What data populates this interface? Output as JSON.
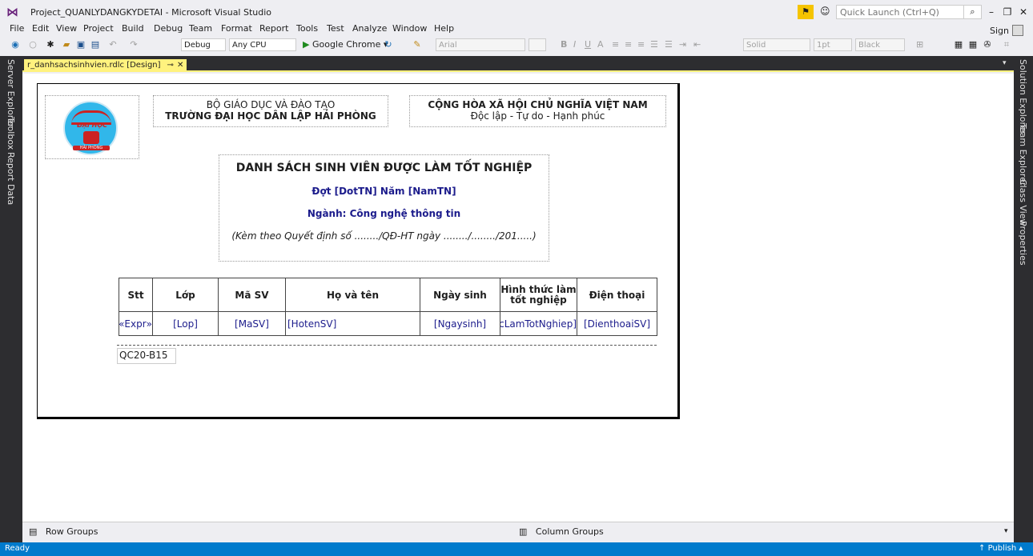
{
  "window": {
    "title": "Project_QUANLYDANGKYDETAI - Microsoft Visual Studio",
    "quick_launch_placeholder": "Quick Launch (Ctrl+Q)",
    "sign_in": "Sign in"
  },
  "menu": [
    "File",
    "Edit",
    "View",
    "Project",
    "Build",
    "Debug",
    "Team",
    "Format",
    "Report",
    "Tools",
    "Test",
    "Analyze",
    "Window",
    "Help"
  ],
  "toolbar": {
    "config": "Debug",
    "platform": "Any CPU",
    "start_target": "Google Chrome",
    "font_name": "Arial",
    "line_style": "Solid",
    "line_width": "1pt",
    "line_color": "Black"
  },
  "left_tabs": [
    "Server Explorer",
    "Toolbox",
    "Report Data"
  ],
  "right_tabs": [
    "Solution Explorer",
    "Team Explorer",
    "Class View",
    "Properties"
  ],
  "document_tab": "r_danhsachsinhvien.rdlc [Design]",
  "report": {
    "logo": {
      "top_text": "ĐẠI HỌC",
      "bottom_text": "HẢI PHÒNG"
    },
    "school_line1": "BỘ GIÁO DỤC VÀ ĐÀO TẠO",
    "school_line2": "TRƯỜNG ĐẠI HỌC DÂN LẬP HẢI PHÒNG",
    "nation_line1": "CỘNG HÒA XÃ HỘI CHỦ NGHĨA VIỆT NAM",
    "nation_line2": "Độc lập - Tự do - Hạnh phúc",
    "title": "DANH SÁCH SINH VIÊN ĐƯỢC LÀM TỐT NGHIỆP",
    "batch": "Đợt [DotTN] Năm [NamTN]",
    "major": "Ngành: Công nghệ thông tin",
    "note": "(Kèm theo Quyết định số ......../QĐ-HT ngày ......../......../201.....)",
    "table": {
      "headers": [
        "Stt",
        "Lớp",
        "Mã SV",
        "Họ và tên",
        "Ngày sinh",
        "Hình thức làm tốt nghiệp",
        "Điện thoại"
      ],
      "row": [
        "«Expr»",
        "[Lop]",
        "[MaSV]",
        "[HotenSV]",
        "[Ngaysinh]",
        "[HinhThucLamTotNghiep]",
        "[DienthoaiSV]"
      ]
    },
    "footer_code": "QC20-B15"
  },
  "group_pane": {
    "row_groups": "Row Groups",
    "column_groups": "Column Groups"
  },
  "status": {
    "text": "Ready",
    "publish": "Publish"
  }
}
